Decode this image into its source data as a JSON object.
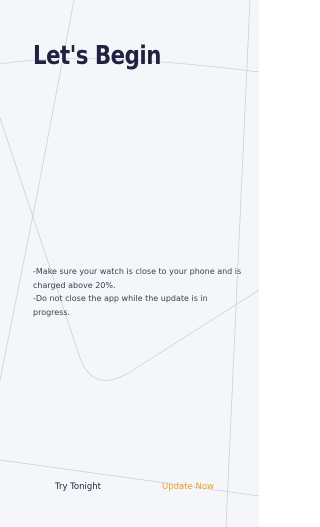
{
  "header": {
    "title": "Let's Begin"
  },
  "instructions": [
    "-Make sure your watch is close to your phone and is charged above 20%.",
    "-Do not close the app while the update is in progress."
  ],
  "actions": {
    "secondary_label": "Try Tonight",
    "primary_label": "Update Now"
  },
  "colors": {
    "background": "#f5f6f9",
    "title": "#1f2340",
    "body_text": "#3b3d52",
    "accent": "#f0a21f",
    "decor_lines": "#c9ccd6"
  }
}
